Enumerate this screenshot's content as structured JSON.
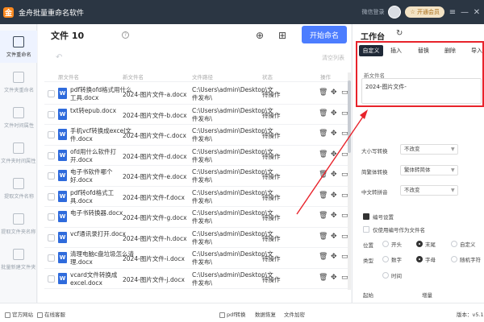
{
  "titlebar": {
    "app_title": "金舟批量重命名软件",
    "logo_letter": "金",
    "login": "微信登录",
    "vip": "☆ 开通会员",
    "controls": [
      "≡",
      "—",
      "✕"
    ]
  },
  "sidebar": {
    "items": [
      {
        "label": "文件重命名",
        "active": true
      },
      {
        "label": "文件夹重命名"
      },
      {
        "label": "文件时间属性"
      },
      {
        "label": "文件夹时间属性"
      },
      {
        "label": "提取文件名称"
      },
      {
        "label": "提取文件夹名称"
      },
      {
        "label": "批量新建文件夹"
      }
    ]
  },
  "main": {
    "title": "文件 10",
    "start_button": "开始命名",
    "clear_link": "清空列表",
    "columns": [
      "原文件名",
      "新文件名",
      "文件路径",
      "状态",
      "操作"
    ],
    "rows": [
      {
        "orig": "pdf转换ofd格式用什么工具.docx",
        "new": "2024-图片文件-a.docx",
        "path": "C:\\Users\\admin\\Desktop\\文件发布\\",
        "status": "待操作"
      },
      {
        "orig": "txt转epub.docx",
        "new": "2024-图片文件-b.docx",
        "path": "C:\\Users\\admin\\Desktop\\文件发布\\",
        "status": "待操作"
      },
      {
        "orig": "手机vcf转换成excel文件.docx",
        "new": "2024-图片文件-c.docx",
        "path": "C:\\Users\\admin\\Desktop\\文件发布\\",
        "status": "待操作"
      },
      {
        "orig": "ofd用什么软件打开.docx",
        "new": "2024-图片文件-d.docx",
        "path": "C:\\Users\\admin\\Desktop\\文件发布\\",
        "status": "待操作"
      },
      {
        "orig": "电子书软件哪个好.docx",
        "new": "2024-图片文件-e.docx",
        "path": "C:\\Users\\admin\\Desktop\\文件发布\\",
        "status": "待操作"
      },
      {
        "orig": "pdf转ofd格式工具.docx",
        "new": "2024-图片文件-f.docx",
        "path": "C:\\Users\\admin\\Desktop\\文件发布\\",
        "status": "待操作"
      },
      {
        "orig": "电子书转换器.docx",
        "new": "2024-图片文件-g.docx",
        "path": "C:\\Users\\admin\\Desktop\\文件发布\\",
        "status": "待操作"
      },
      {
        "orig": "vcf通讯录打开.docx",
        "new": "2024-图片文件-h.docx",
        "path": "C:\\Users\\admin\\Desktop\\文件发布\\",
        "status": "待操作"
      },
      {
        "orig": "清理电脑c盘垃圾怎么清理.docx",
        "new": "2024-图片文件-i.docx",
        "path": "C:\\Users\\admin\\Desktop\\文件发布\\",
        "status": "待操作"
      },
      {
        "orig": "vcard文件转换成excel.docx",
        "new": "2024-图片文件-j.docx",
        "path": "C:\\Users\\admin\\Desktop\\文件发布\\",
        "status": "待操作"
      }
    ]
  },
  "panel": {
    "title": "工作台",
    "tabs": [
      "自定义",
      "插入",
      "替换",
      "删除",
      "导入"
    ],
    "new_name_label": "新文件名",
    "new_name_value": "2024-图片文件-",
    "case_label": "大小写转换",
    "case_value": "不改变",
    "trad_label": "简繁体转换",
    "trad_value": "繁体转简体",
    "pinyin_label": "中文转拼音",
    "pinyin_value": "不改变",
    "numbering_label": "编号设置",
    "use_number_only": "仅使用编号作为文件名",
    "position_label": "位置",
    "position_options": [
      "开头",
      "末尾",
      "自定义"
    ],
    "type_label": "类型",
    "type_options": [
      "数字",
      "字母",
      "随机字符"
    ],
    "time_option": "时间",
    "start_label": "起始",
    "step_label": "增量"
  },
  "bottombar": {
    "website": "官方网站",
    "support": "在线客服",
    "tools": [
      "pdf转换",
      "数据恢复",
      "文件加密"
    ],
    "version": "版本：v5.1"
  }
}
